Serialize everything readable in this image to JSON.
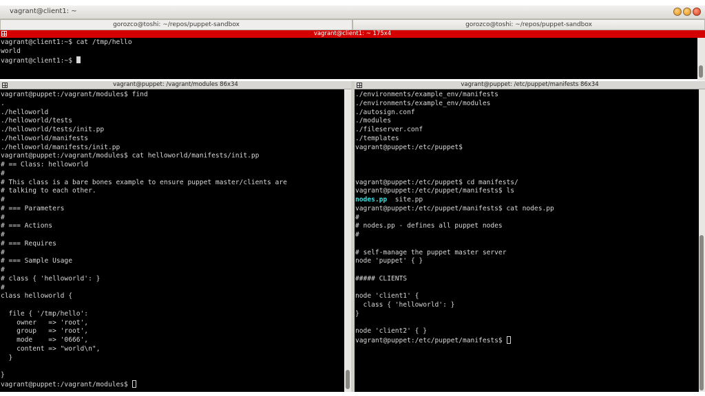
{
  "window": {
    "title": "vagrant@client1: ~",
    "buttons": [
      "minimize",
      "maximize",
      "close"
    ]
  },
  "tabs": [
    {
      "label": "gorozco@toshi: ~/repos/puppet-sandbox"
    },
    {
      "label": "gorozco@toshi: ~/repos/puppet-sandbox"
    }
  ],
  "top_pane": {
    "header": "vagrant@client1: ~ 175x4",
    "lines": [
      "vagrant@client1:~$ cat /tmp/hello",
      "world"
    ],
    "prompt": "vagrant@client1:~$ "
  },
  "left_pane": {
    "header": "vagrant@puppet: /vagrant/modules 86x34",
    "lines": [
      "vagrant@puppet:/vagrant/modules$ find",
      ".",
      "./helloworld",
      "./helloworld/tests",
      "./helloworld/tests/init.pp",
      "./helloworld/manifests",
      "./helloworld/manifests/init.pp",
      "vagrant@puppet:/vagrant/modules$ cat helloworld/manifests/init.pp",
      "# == Class: helloworld",
      "#",
      "# This class is a bare bones example to ensure puppet master/clients are",
      "# talking to each other.",
      "#",
      "# === Parameters",
      "#",
      "# === Actions",
      "#",
      "# === Requires",
      "#",
      "# === Sample Usage",
      "#",
      "# class { 'helloworld': }",
      "#",
      "class helloworld {",
      "",
      "  file { '/tmp/hello':",
      "    owner   => 'root',",
      "    group   => 'root',",
      "    mode    => '0666',",
      "    content => \"world\\n\",",
      "  }",
      "",
      "}"
    ],
    "prompt": "vagrant@puppet:/vagrant/modules$ "
  },
  "right_pane": {
    "header": "vagrant@puppet: /etc/puppet/manifests 86x34",
    "lines_a": [
      "./environments/example_env/manifests",
      "./environments/example_env/modules",
      "./autosign.conf",
      "./modules",
      "./fileserver.conf",
      "./templates",
      "vagrant@puppet:/etc/puppet$",
      "",
      "",
      "",
      "vagrant@puppet:/etc/puppet$ cd manifests/",
      "vagrant@puppet:/etc/puppet/manifests$ ls"
    ],
    "ls_highlight": "nodes.pp",
    "ls_rest": "  site.pp",
    "lines_b": [
      "vagrant@puppet:/etc/puppet/manifests$ cat nodes.pp",
      "#",
      "# nodes.pp - defines all puppet nodes",
      "#",
      "",
      "# self-manage the puppet master server",
      "node 'puppet' { }",
      "",
      "##### CLIENTS",
      "",
      "node 'client1' {",
      "  class { 'helloworld': }",
      "}",
      "",
      "node 'client2' { }"
    ],
    "prompt": "vagrant@puppet:/etc/puppet/manifests$ "
  }
}
